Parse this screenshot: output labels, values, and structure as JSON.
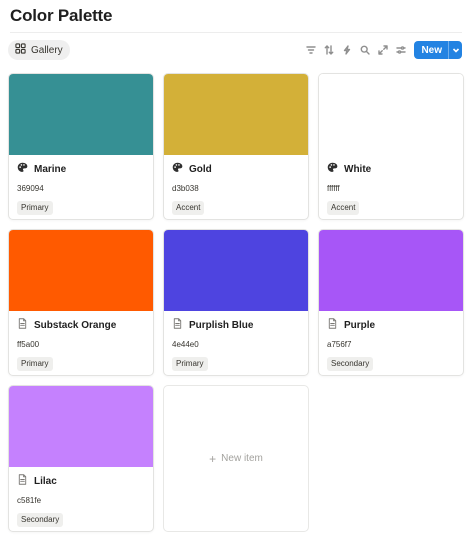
{
  "page": {
    "title": "Color Palette"
  },
  "view": {
    "tab_label": "Gallery",
    "tab_icon": "gallery-grid-icon"
  },
  "toolbar": {
    "icons": [
      "filter-icon",
      "sort-icon",
      "lightning-icon",
      "search-icon",
      "expand-icon",
      "settings-sliders-icon"
    ],
    "new_label": "New"
  },
  "colors": {
    "border": "#e3e3e1",
    "accent": "#2383e2",
    "tag_bg": "#efefed"
  },
  "cards": [
    {
      "name": "Marine",
      "hex": "369094",
      "tag": "Primary",
      "swatch": "#369094",
      "icon": "palette-icon"
    },
    {
      "name": "Gold",
      "hex": "d3b038",
      "tag": "Accent",
      "swatch": "#d3b038",
      "icon": "palette-icon"
    },
    {
      "name": "White",
      "hex": "ffffff",
      "tag": "Accent",
      "swatch": "#ffffff",
      "icon": "palette-icon"
    },
    {
      "name": "Substack Orange",
      "hex": "ff5a00",
      "tag": "Primary",
      "swatch": "#ff5a00",
      "icon": "page-icon"
    },
    {
      "name": "Purplish Blue",
      "hex": "4e44e0",
      "tag": "Primary",
      "swatch": "#4e44e0",
      "icon": "page-icon"
    },
    {
      "name": "Purple",
      "hex": "a756f7",
      "tag": "Secondary",
      "swatch": "#a756f7",
      "icon": "page-icon"
    },
    {
      "name": "Lilac",
      "hex": "c581fe",
      "tag": "Secondary",
      "swatch": "#c581fe",
      "icon": "page-icon"
    }
  ],
  "new_item": {
    "label": "New item"
  }
}
